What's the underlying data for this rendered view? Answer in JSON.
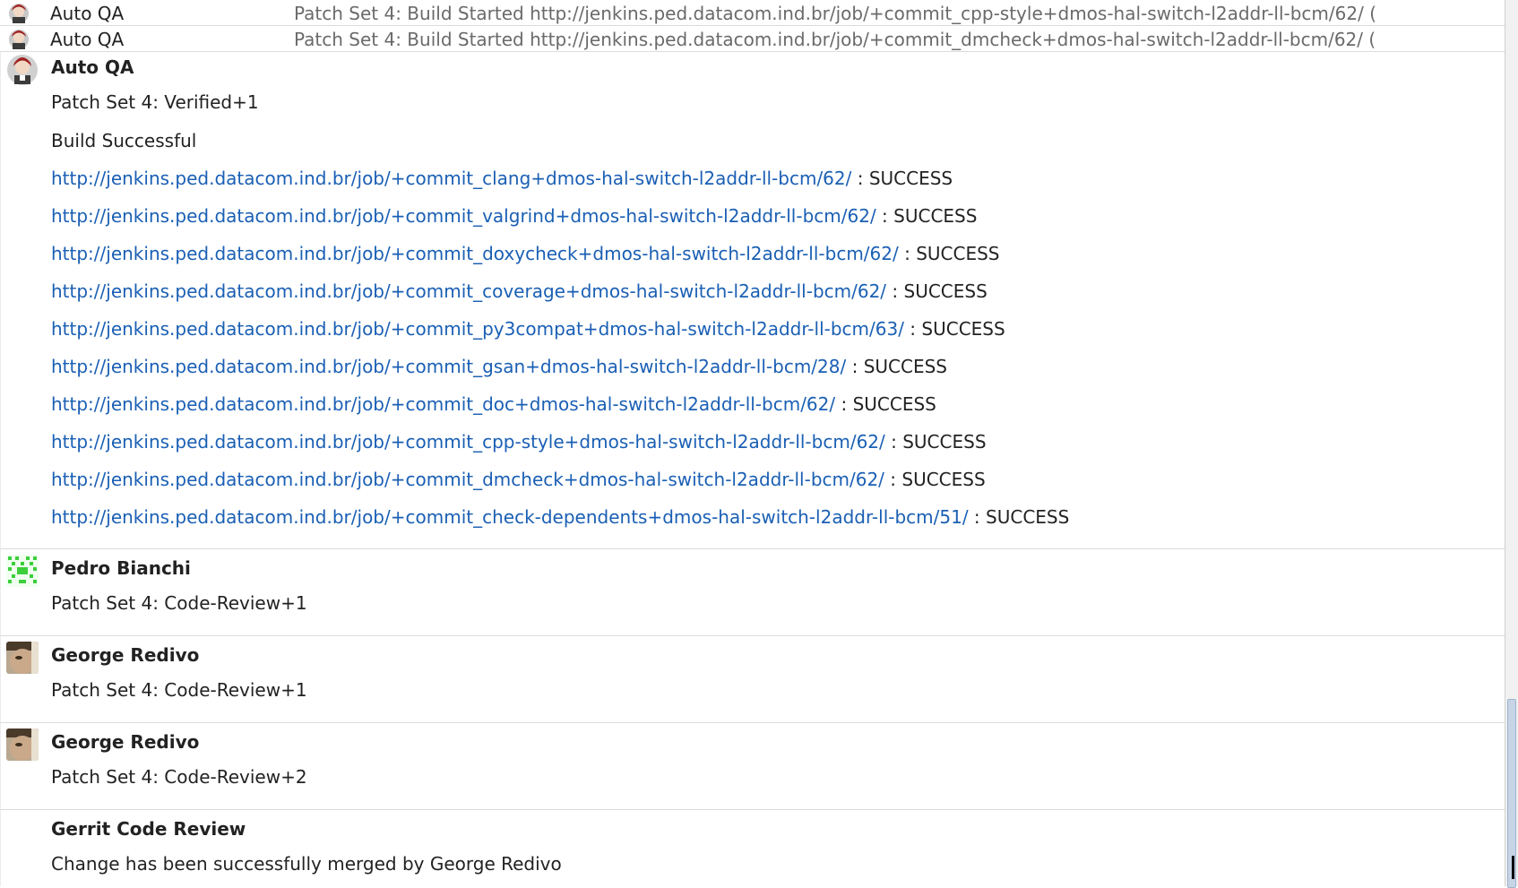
{
  "collapsed": [
    {
      "author": "Auto QA",
      "summary": "Patch Set 4: Build Started http://jenkins.ped.datacom.ind.br/job/+commit_cpp-style+dmos-hal-switch-l2addr-ll-bcm/62/ ("
    },
    {
      "author": "Auto QA",
      "summary": "Patch Set 4: Build Started http://jenkins.ped.datacom.ind.br/job/+commit_dmcheck+dmos-hal-switch-l2addr-ll-bcm/62/ ("
    }
  ],
  "messages": {
    "autoqa": {
      "author": "Auto QA",
      "verified": "Patch Set 4: Verified+1",
      "build_status": "Build Successful",
      "results": [
        {
          "url": "http://jenkins.ped.datacom.ind.br/job/+commit_clang+dmos-hal-switch-l2addr-ll-bcm/62/",
          "status": " : SUCCESS"
        },
        {
          "url": "http://jenkins.ped.datacom.ind.br/job/+commit_valgrind+dmos-hal-switch-l2addr-ll-bcm/62/",
          "status": " : SUCCESS"
        },
        {
          "url": "http://jenkins.ped.datacom.ind.br/job/+commit_doxycheck+dmos-hal-switch-l2addr-ll-bcm/62/",
          "status": " : SUCCESS"
        },
        {
          "url": "http://jenkins.ped.datacom.ind.br/job/+commit_coverage+dmos-hal-switch-l2addr-ll-bcm/62/",
          "status": " : SUCCESS"
        },
        {
          "url": "http://jenkins.ped.datacom.ind.br/job/+commit_py3compat+dmos-hal-switch-l2addr-ll-bcm/63/",
          "status": " : SUCCESS"
        },
        {
          "url": "http://jenkins.ped.datacom.ind.br/job/+commit_gsan+dmos-hal-switch-l2addr-ll-bcm/28/",
          "status": " : SUCCESS"
        },
        {
          "url": "http://jenkins.ped.datacom.ind.br/job/+commit_doc+dmos-hal-switch-l2addr-ll-bcm/62/",
          "status": " : SUCCESS"
        },
        {
          "url": "http://jenkins.ped.datacom.ind.br/job/+commit_cpp-style+dmos-hal-switch-l2addr-ll-bcm/62/",
          "status": " : SUCCESS"
        },
        {
          "url": "http://jenkins.ped.datacom.ind.br/job/+commit_dmcheck+dmos-hal-switch-l2addr-ll-bcm/62/",
          "status": " : SUCCESS"
        },
        {
          "url": "http://jenkins.ped.datacom.ind.br/job/+commit_check-dependents+dmos-hal-switch-l2addr-ll-bcm/51/",
          "status": " : SUCCESS"
        }
      ]
    },
    "pedro": {
      "author": "Pedro Bianchi",
      "text": "Patch Set 4: Code-Review+1"
    },
    "george1": {
      "author": "George Redivo",
      "text": "Patch Set 4: Code-Review+1"
    },
    "george2": {
      "author": "George Redivo",
      "text": "Patch Set 4: Code-Review+2"
    },
    "gerrit": {
      "author": "Gerrit Code Review",
      "text": "Change has been successfully merged by George Redivo"
    }
  },
  "colors": {
    "link": "#1a5fb4",
    "muted": "#6a6a6a",
    "border": "#dcdcdc"
  }
}
